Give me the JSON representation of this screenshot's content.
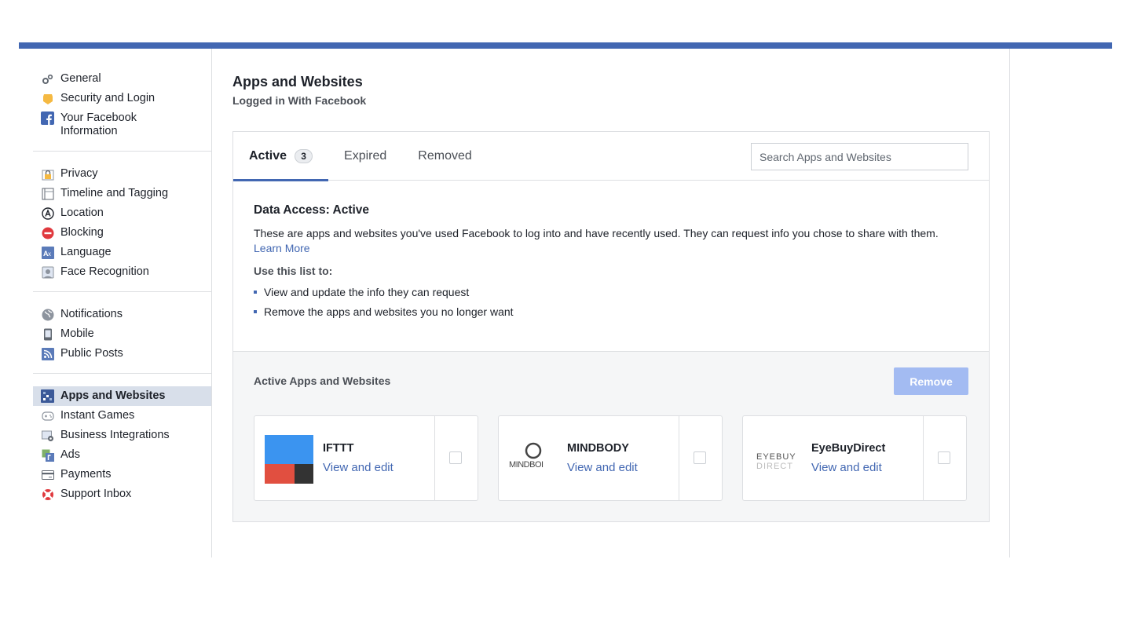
{
  "sidebar": {
    "groups": [
      [
        {
          "label": "General",
          "icon": "gears-icon"
        },
        {
          "label": "Security and Login",
          "icon": "badge-icon"
        },
        {
          "label": "Your Facebook Information",
          "icon": "facebook-icon"
        }
      ],
      [
        {
          "label": "Privacy",
          "icon": "lock-icon"
        },
        {
          "label": "Timeline and Tagging",
          "icon": "timeline-icon"
        },
        {
          "label": "Location",
          "icon": "location-icon"
        },
        {
          "label": "Blocking",
          "icon": "blocking-icon"
        },
        {
          "label": "Language",
          "icon": "language-icon"
        },
        {
          "label": "Face Recognition",
          "icon": "face-icon"
        }
      ],
      [
        {
          "label": "Notifications",
          "icon": "globe-icon"
        },
        {
          "label": "Mobile",
          "icon": "mobile-icon"
        },
        {
          "label": "Public Posts",
          "icon": "rss-icon"
        }
      ],
      [
        {
          "label": "Apps and Websites",
          "icon": "apps-icon",
          "active": true
        },
        {
          "label": "Instant Games",
          "icon": "gamepad-icon"
        },
        {
          "label": "Business Integrations",
          "icon": "business-icon"
        },
        {
          "label": "Ads",
          "icon": "ads-icon"
        },
        {
          "label": "Payments",
          "icon": "card-icon"
        },
        {
          "label": "Support Inbox",
          "icon": "lifebuoy-icon"
        }
      ]
    ]
  },
  "header": {
    "title": "Apps and Websites",
    "subtitle": "Logged in With Facebook"
  },
  "tabs": {
    "active_label": "Active",
    "active_count": "3",
    "expired_label": "Expired",
    "removed_label": "Removed"
  },
  "search": {
    "placeholder": "Search Apps and Websites"
  },
  "info": {
    "title": "Data Access: Active",
    "description": "These are apps and websites you've used Facebook to log into and have recently used. They can request info you chose to share with them.",
    "learn_more": "Learn More",
    "use_heading": "Use this list to:",
    "bullets": [
      "View and update the info they can request",
      "Remove the apps and websites you no longer want"
    ]
  },
  "apps_list": {
    "heading": "Active Apps and Websites",
    "remove_label": "Remove",
    "apps": [
      {
        "name": "IFTTT",
        "link": "View and edit",
        "logo": "ifttt-logo"
      },
      {
        "name": "MINDBODY",
        "link": "View and edit",
        "logo": "mindbody-logo",
        "logo_text": "MINDBOI"
      },
      {
        "name": "EyeBuyDirect",
        "link": "View and edit",
        "logo": "eyebuydirect-logo",
        "logo_text_1": "EYEBUY",
        "logo_text_2": "DIRECT"
      }
    ]
  },
  "colors": {
    "brand": "#4267b2",
    "active_sidebar_bg": "#d8dfea",
    "remove_disabled": "#a3bbf2"
  }
}
